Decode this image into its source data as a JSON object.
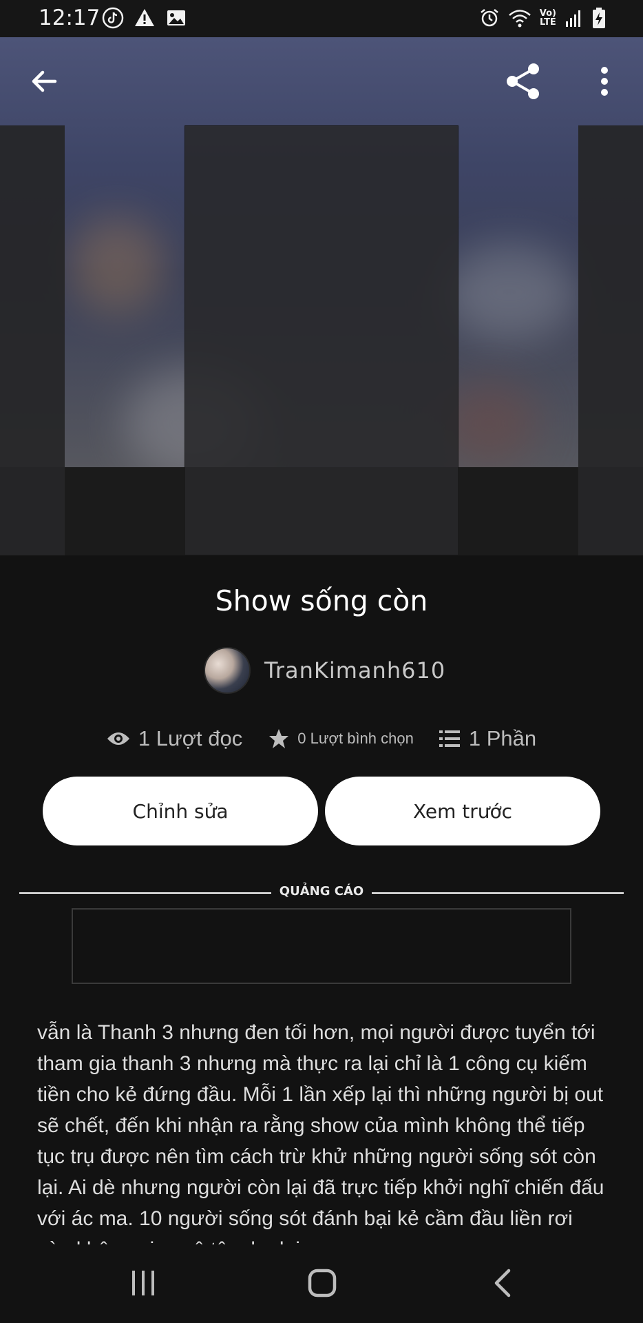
{
  "status_bar": {
    "time": "12:17",
    "lte_top": "Vo)",
    "lte_bottom": "LTE",
    "left_icons": [
      "tiktok-icon",
      "warning-icon",
      "image-icon"
    ],
    "right_icons": [
      "alarm-icon",
      "wifi-icon",
      "volte-icon",
      "signal-icon",
      "battery-charging-icon"
    ]
  },
  "toolbar": {
    "back_icon": "arrow-left-icon",
    "share_icon": "share-icon",
    "more_icon": "more-vert-icon"
  },
  "story": {
    "title": "Show sống còn",
    "author": "TranKimanh610",
    "reads": "1 Lượt đọc",
    "votes": "0 Lượt bình chọn",
    "parts": "1 Phần"
  },
  "actions": {
    "edit_label": "Chỉnh sửa",
    "preview_label": "Xem trước"
  },
  "ad": {
    "label": "QUẢNG CÁO"
  },
  "description": "vẫn là Thanh 3 nhưng đen tối hơn, mọi người được tuyển tới tham gia thanh 3 nhưng mà thực ra lại chỉ là 1 công cụ kiếm tiền cho kẻ đứng đầu. Mỗi 1 lần xếp lại thì những người bị out sẽ chết, đến khi nhận ra rằng show của mình không thể tiếp tục trụ được nên tìm cách trừ khử những người sống sót còn lại. Ai dè nhưng người còn lại đã trực tiếp khởi nghĩ chiến đấu với ác ma. 10 người sống sót đánh bại kẻ cầm đầu liền rơi vào không gian vô tận, họ lại",
  "nav": {
    "recents_icon": "recent-apps-icon",
    "home_icon": "home-icon",
    "back_icon": "nav-back-icon"
  },
  "colors": {
    "background": "#121212",
    "button_bg": "#ffffff",
    "button_text": "#222222",
    "cover_top": "#4d5478"
  }
}
